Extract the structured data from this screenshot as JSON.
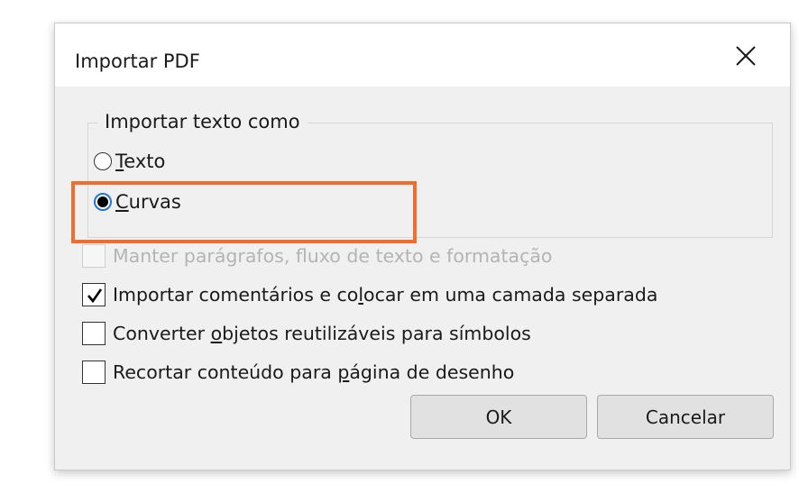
{
  "dialog": {
    "title": "Importar PDF",
    "close_icon": "close-icon"
  },
  "import_text_group": {
    "label": "Importar texto como",
    "options": [
      {
        "pre": "",
        "key": "T",
        "post": "exto",
        "full": "Texto",
        "selected": false
      },
      {
        "pre": "",
        "key": "C",
        "post": "urvas",
        "full": "Curvas",
        "selected": true
      }
    ],
    "highlight_color": "#ee6d2f"
  },
  "checkboxes": [
    {
      "pre": "Manter parágrafos, fluxo de texto e formatação",
      "key": "",
      "post": "",
      "checked": false,
      "disabled": true
    },
    {
      "pre": "Importar comentários e co",
      "key": "l",
      "post": "ocar em uma camada separada",
      "checked": true,
      "disabled": false
    },
    {
      "pre": "Converter ",
      "key": "o",
      "post": "bjetos reutilizáveis para símbolos",
      "checked": false,
      "disabled": false
    },
    {
      "pre": "Recortar conteúdo para ",
      "key": "p",
      "post": "ágina de desenho",
      "checked": false,
      "disabled": false
    }
  ],
  "buttons": {
    "ok": "OK",
    "cancel": "Cancelar"
  }
}
